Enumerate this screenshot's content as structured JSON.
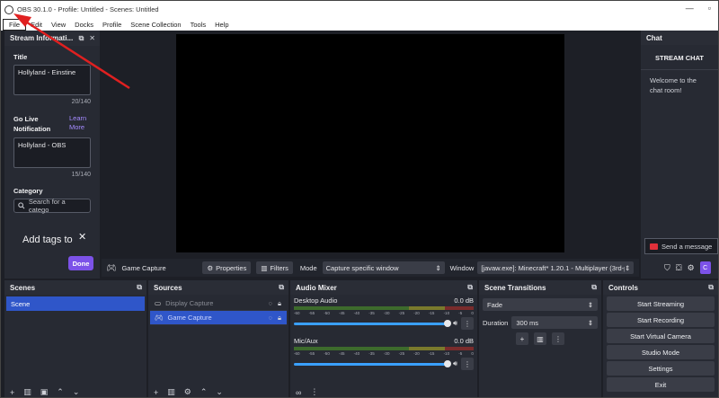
{
  "window": {
    "title": "OBS 30.1.0 - Profile: Untitled - Scenes: Untitled"
  },
  "menu": [
    "File",
    "Edit",
    "View",
    "Docks",
    "Profile",
    "Scene Collection",
    "Tools",
    "Help"
  ],
  "stream_info": {
    "header": "Stream Informati...",
    "title_label": "Title",
    "title_value": "Hollyland - Einstine",
    "title_counter": "20/140",
    "golive_label": "Go Live Notification",
    "learn_more": "Learn More",
    "golive_value": "Hollyland - OBS",
    "golive_counter": "15/140",
    "category_label": "Category",
    "category_placeholder": "Search for a catego",
    "tags_label": "Add tags to",
    "done_label": "Done"
  },
  "source_toolbar": {
    "source_name": "Game Capture",
    "properties": "Properties",
    "filters": "Filters",
    "mode_label": "Mode",
    "mode_value": "Capture specific window",
    "window_label": "Window",
    "window_value": "[javaw.exe]: Minecraft* 1.20.1 - Multiplayer (3rd-p"
  },
  "chat": {
    "header": "Chat",
    "title": "STREAM CHAT",
    "welcome": "Welcome to the chat room!",
    "send_placeholder": "Send a message"
  },
  "scenes": {
    "header": "Scenes",
    "items": [
      "Scene"
    ]
  },
  "sources": {
    "header": "Sources",
    "items": [
      "Display Capture",
      "Game Capture"
    ]
  },
  "audio": {
    "header": "Audio Mixer",
    "channels": [
      {
        "name": "Desktop Audio",
        "level": "0.0 dB"
      },
      {
        "name": "Mic/Aux",
        "level": "0.0 dB"
      }
    ],
    "ticks": [
      "-60",
      "-55",
      "-50",
      "-45",
      "-40",
      "-35",
      "-30",
      "-25",
      "-20",
      "-15",
      "-10",
      "-5",
      "0"
    ]
  },
  "transitions": {
    "header": "Scene Transitions",
    "type": "Fade",
    "duration_label": "Duration",
    "duration_value": "300 ms"
  },
  "controls": {
    "header": "Controls",
    "buttons": [
      "Start Streaming",
      "Start Recording",
      "Start Virtual Camera",
      "Studio Mode",
      "Settings",
      "Exit"
    ]
  },
  "colors": {
    "accent_purple": "#7c52e8",
    "selection_blue": "#2f56c9",
    "annotation_red": "#e02020"
  }
}
